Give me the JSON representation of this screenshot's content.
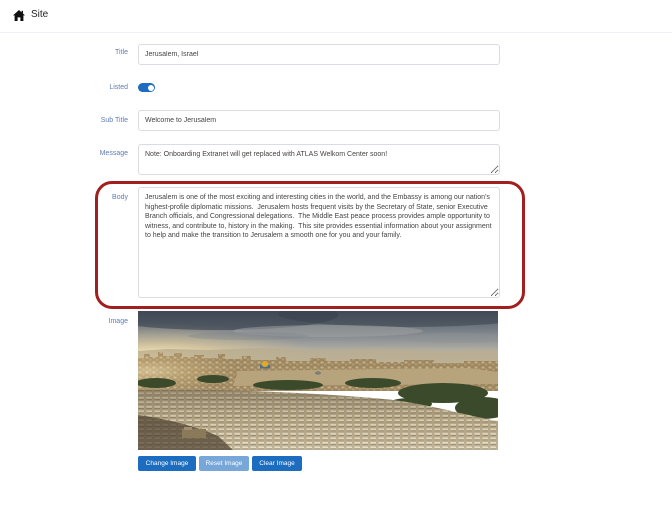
{
  "header": {
    "icon": "home-icon",
    "title": "Site"
  },
  "form": {
    "title": {
      "label": "Title",
      "value": "Jerusalem, Israel"
    },
    "listed": {
      "label": "Listed",
      "checked": true
    },
    "subtitle": {
      "label": "Sub Title",
      "value": "Welcome to Jerusalem"
    },
    "message": {
      "label": "Message",
      "value": "Note: Onboarding Extranet will get replaced with ATLAS Welkom Center soon!"
    },
    "body": {
      "label": "Body",
      "value": "Jerusalem is one of the most exciting and interesting cities in the world, and the Embassy is among our nation's highest-profile diplomatic missions.  Jerusalem hosts frequent visits by the Secretary of State, senior Executive Branch officials, and Congressional delegations.  The Middle East peace process provides ample opportunity to witness, and contribute to, history in the making.  This site provides essential information about your assignment to help and make the transition to Jerusalem a smooth one for you and your family."
    },
    "image": {
      "label": "Image",
      "buttons": [
        {
          "label": "Change Image",
          "disabled": false
        },
        {
          "label": "Reset Image",
          "disabled": true
        },
        {
          "label": "Clear Image",
          "disabled": false
        }
      ]
    }
  },
  "colors": {
    "accent": "#1c6dbf",
    "label": "#5e7cb5",
    "annotation": "#a11f1f"
  }
}
